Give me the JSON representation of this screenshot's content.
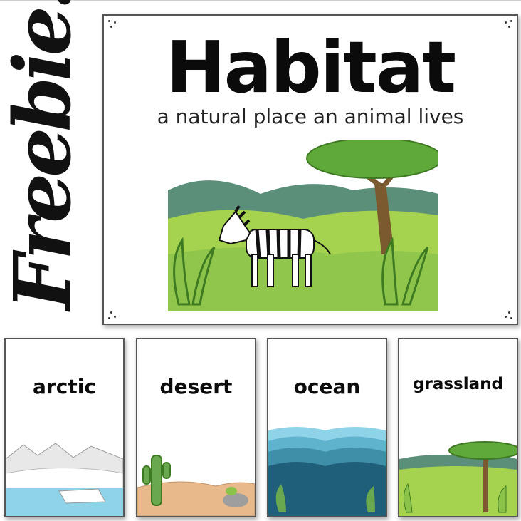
{
  "side_banner": {
    "text": "Freebie!"
  },
  "main_card": {
    "title": "Habitat",
    "subtitle": "a natural place an animal lives"
  },
  "habitat_cards": [
    {
      "label": "arctic"
    },
    {
      "label": "desert"
    },
    {
      "label": "ocean"
    },
    {
      "label": "grassland"
    }
  ],
  "colors": {
    "grass_light": "#a5d34f",
    "grass_mid": "#8bc34a",
    "hill_dark": "#5b8f7a",
    "tree_green": "#5fa83a",
    "trunk_brown": "#7a5a2e",
    "ice": "#e8e8e8",
    "water_light": "#8fd3e8",
    "sand": "#e8b98a",
    "ocean_dark": "#1f5f7a",
    "ocean_mid": "#3f8fa8"
  }
}
